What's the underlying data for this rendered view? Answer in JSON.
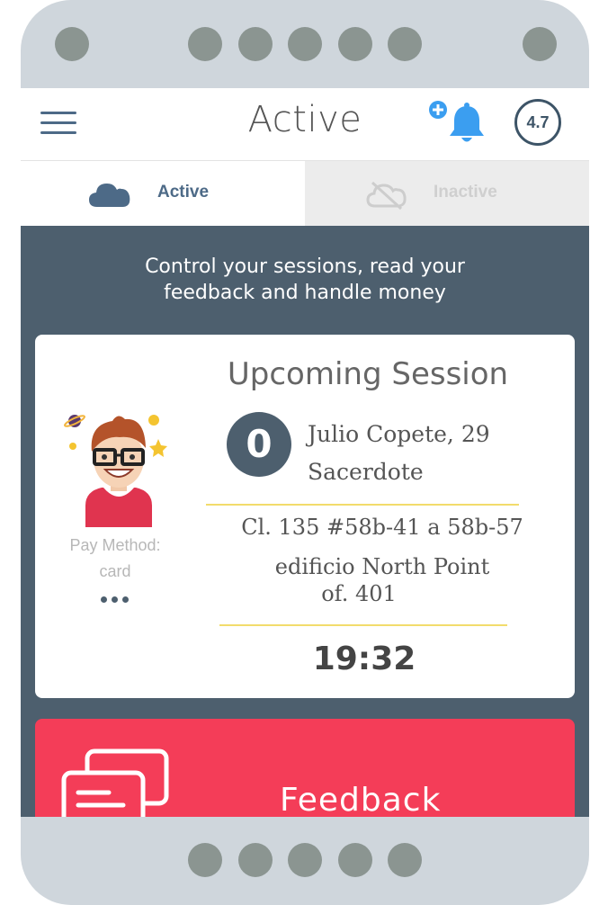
{
  "header": {
    "title": "Active",
    "rating": "4.7"
  },
  "tabs": [
    {
      "label": "Active",
      "color": "#4d6a87",
      "icon": "cloud-icon"
    },
    {
      "label": "Inactive",
      "color": "#cfcfcf",
      "icon": "cloud-off-icon"
    }
  ],
  "intro": {
    "line1": "Control your sessions, read your",
    "line2": "feedback and handle money"
  },
  "session": {
    "title": "Upcoming Session",
    "count": "0",
    "client_name": "Julio Copete, 29",
    "client_role": "Sacerdote",
    "address_line1": "Cl. 135 #58b-41 a 58b-57",
    "address_line2": "edificio North Point",
    "address_line3": "of. 401",
    "time": "19:32",
    "pay_method_label": "Pay Method:",
    "pay_method_value": "card"
  },
  "feedback": {
    "label": "Feedback"
  },
  "colors": {
    "accent": "#4d6a87",
    "screen_bg": "#4d5f6e",
    "feedback_bg": "#f43d58",
    "separator": "#f2dc6c"
  }
}
